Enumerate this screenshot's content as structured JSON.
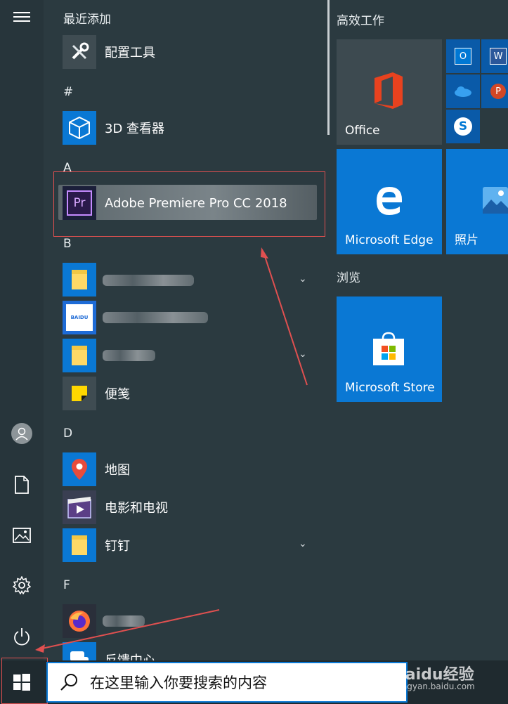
{
  "app_list": {
    "recent_header": "最近添加",
    "recent_app": "配置工具",
    "hash_header": "#",
    "viewer_3d": "3D 查看器",
    "a_header": "A",
    "premiere": "Adobe Premiere Pro CC 2018",
    "premiere_icon_text": "Pr",
    "b_header": "B",
    "sticky_notes": "便笺",
    "baidu_icon_text": "BAIDU",
    "d_header": "D",
    "maps": "地图",
    "movies_tv": "电影和电视",
    "dingtalk": "钉钉",
    "f_header": "F",
    "feedback_hub": "反馈中心"
  },
  "tiles": {
    "group_productivity": "高效工作",
    "office": "Office",
    "outlook_icon_text": "O",
    "word_icon_text": "W",
    "powerpoint_icon_text": "P",
    "skype_icon_text": "S",
    "edge": "Microsoft Edge",
    "photos": "照片",
    "group_browse": "浏览",
    "store": "Microsoft Store"
  },
  "taskbar": {
    "search_placeholder": "在这里输入你要搜索的内容",
    "watermark": "Baidu经验",
    "watermark_sub": "jingyan.baidu.com"
  },
  "colors": {
    "accent": "#0a78d4",
    "annotation": "#e05050",
    "background": "#2b3a40"
  }
}
